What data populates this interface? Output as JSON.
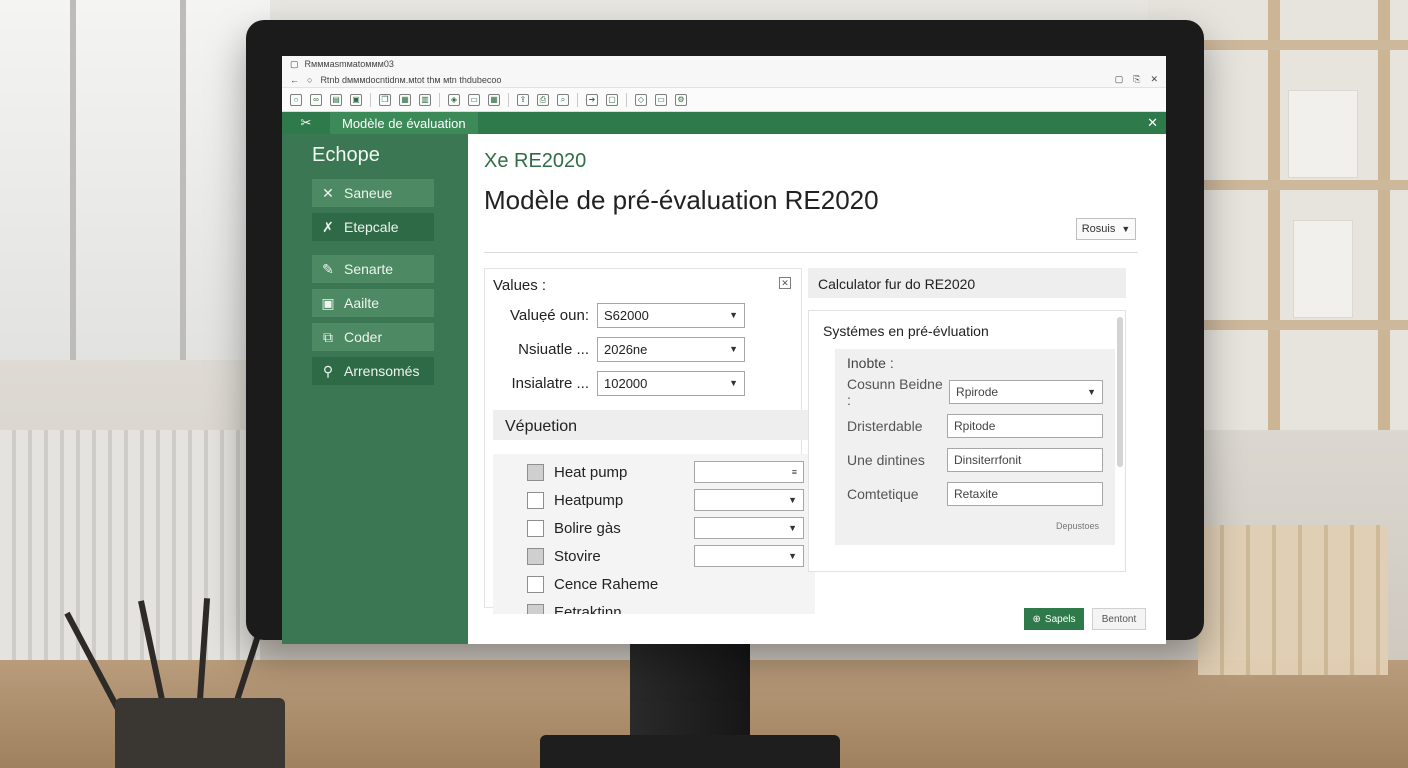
{
  "window": {
    "title_text": "Rᴍᴍᴍasmᴍatoᴍᴍᴍ03",
    "url_text": "Rtnb dᴍᴍᴍdocntidnᴍ.ᴍtot thᴍ ᴍtn thdubecoo",
    "controls": [
      "▢",
      "⎘",
      "✕"
    ]
  },
  "ribbon": {
    "tab_label": "Modèle de évaluation",
    "icon": "tools-icon"
  },
  "sidebar": {
    "title": "Echope",
    "items": [
      {
        "label": "Saneue",
        "icon": "cross-tools-icon"
      },
      {
        "label": "Etepcale",
        "icon": "tools-icon"
      },
      {
        "label": "Senarte",
        "icon": "pencil-icon"
      },
      {
        "label": "Aailte",
        "icon": "image-icon"
      },
      {
        "label": "Coder",
        "icon": "share-icon"
      },
      {
        "label": "Arrensomés",
        "icon": "search-icon"
      }
    ]
  },
  "main": {
    "subtitle": "Xe RE2020",
    "title": "Modèle de pré-évaluation RE2020",
    "preset_label": "Rosuis"
  },
  "values_panel": {
    "heading": "Values :",
    "fields": [
      {
        "label": "Valuẹé oun:",
        "value": "S62000"
      },
      {
        "label": "Nsiuatle ...",
        "value": "2026ne"
      },
      {
        "label": "Insialatre ...",
        "value": "102000"
      }
    ],
    "section_title": "Vépuetion",
    "checks": [
      {
        "label": "Heat pump",
        "checked": true
      },
      {
        "label": "Heatpump",
        "checked": false
      },
      {
        "label": "Bolire gàs",
        "checked": false
      },
      {
        "label": "Stovire",
        "checked": true
      },
      {
        "label": "Cence Raheme",
        "checked": false
      },
      {
        "label": "Eetraktinn",
        "checked": true
      }
    ]
  },
  "calc_panel": {
    "heading": "Calculator fur do RE2020",
    "body_title": "Systémes en pré-évluation",
    "inner_label": "Inobte :",
    "rows": [
      {
        "label": "Cosunn Beidne :",
        "value": "Rpirode",
        "has_caret": true
      },
      {
        "label": "Dristerdable",
        "value": "Rpitode",
        "has_caret": false
      },
      {
        "label": "Une dintines",
        "value": "Dinsiterrfonit",
        "has_caret": false
      },
      {
        "label": "Comtetique",
        "value": "Retaxite",
        "has_caret": false
      }
    ],
    "footer_text": "Depustoes"
  },
  "footer": {
    "save_label": "Sapels",
    "cancel_label": "Bentont"
  }
}
